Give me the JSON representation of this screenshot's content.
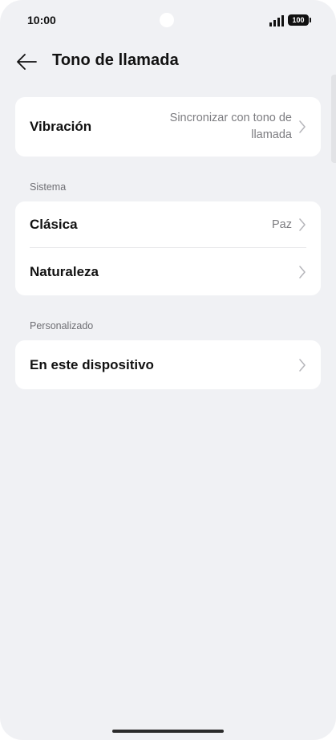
{
  "status_bar": {
    "time": "10:00",
    "battery": "100",
    "icons": [
      "signal-icon",
      "battery-icon"
    ]
  },
  "header": {
    "title": "Tono de llamada",
    "back_icon": "back-arrow-icon"
  },
  "vibration": {
    "label": "Vibración",
    "value": "Sincronizar con tono de llamada"
  },
  "sections": {
    "system": {
      "title": "Sistema",
      "items": [
        {
          "label": "Clásica",
          "value": "Paz"
        },
        {
          "label": "Naturaleza",
          "value": ""
        }
      ]
    },
    "custom": {
      "title": "Personalizado",
      "items": [
        {
          "label": "En este dispositivo",
          "value": ""
        }
      ]
    }
  },
  "colors": {
    "background": "#f0f1f4",
    "card": "#ffffff",
    "text_primary": "#111111",
    "text_secondary": "#7c7c80",
    "chevron": "#b5b5ba"
  }
}
